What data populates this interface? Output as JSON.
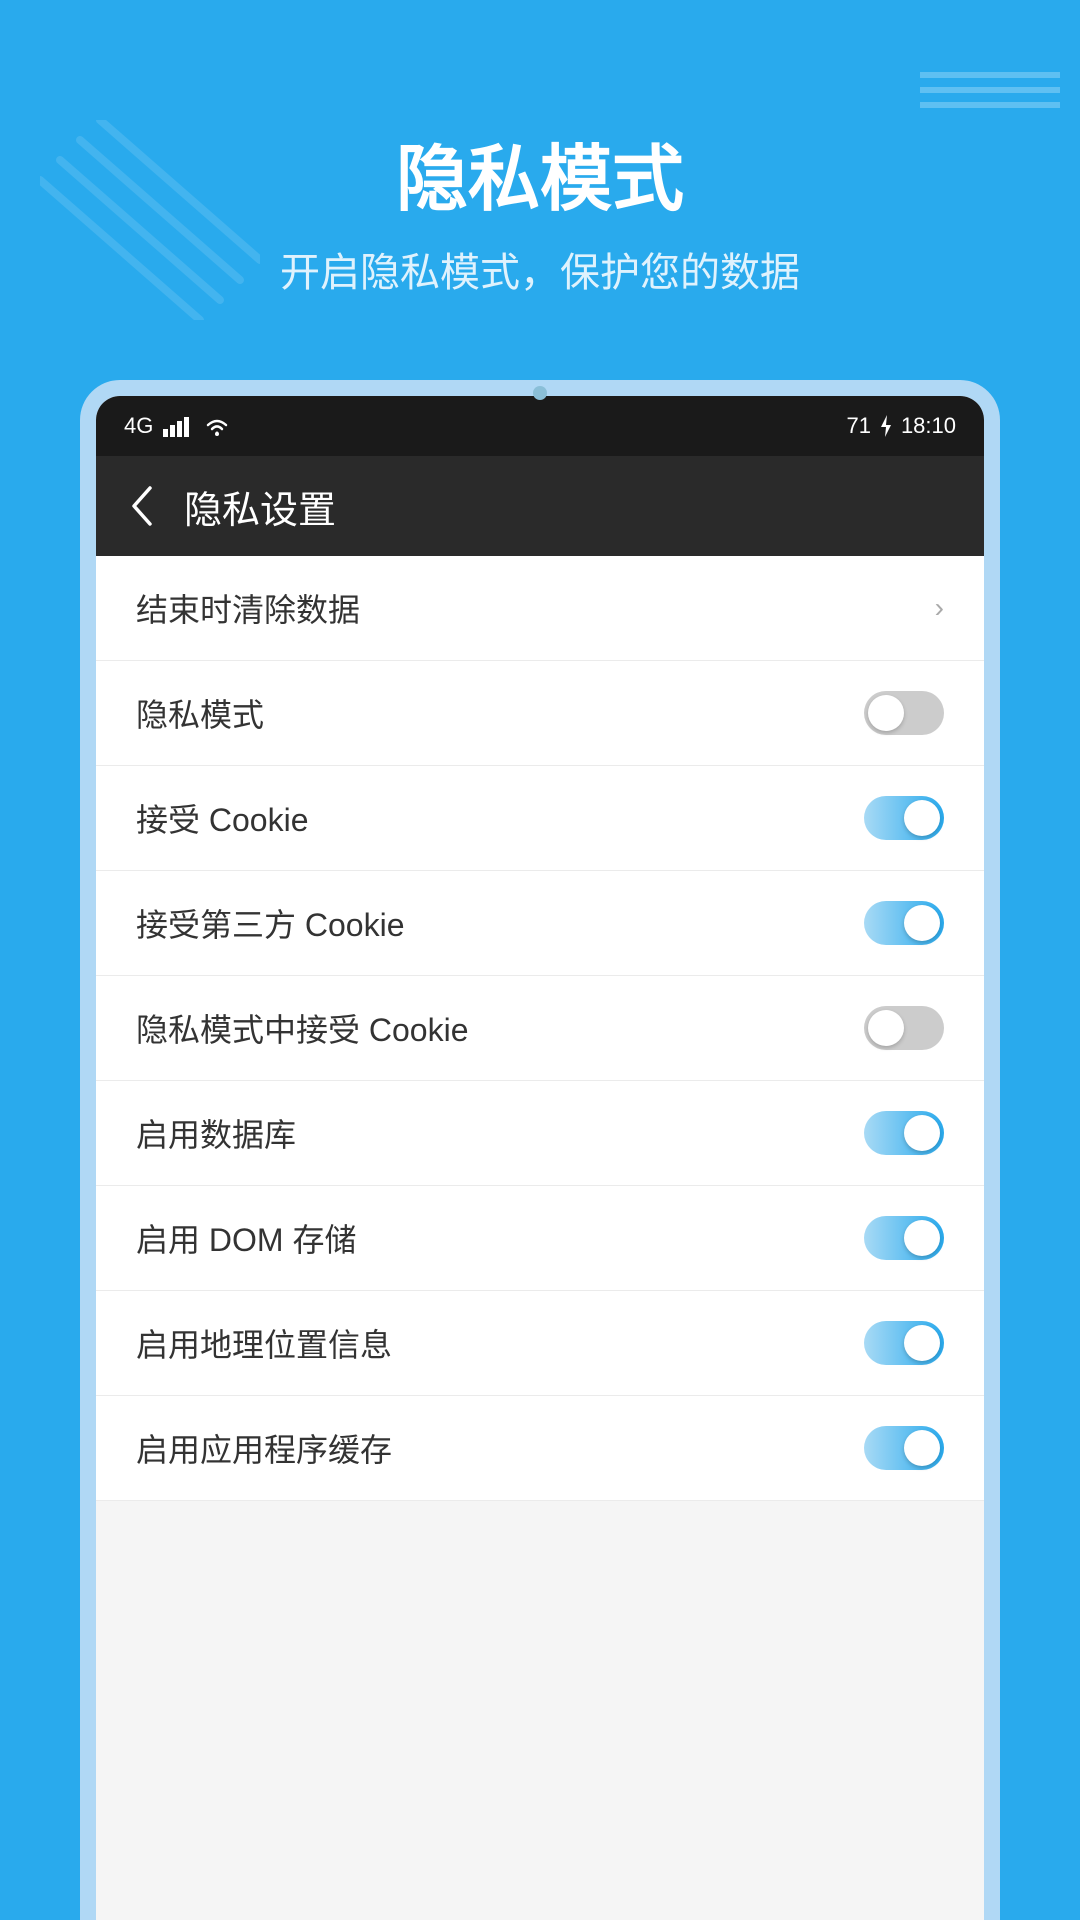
{
  "background_color": "#29aaed",
  "page": {
    "title": "隐私模式",
    "subtitle": "开启隐私模式，保护您的数据"
  },
  "status_bar": {
    "signal": "4G",
    "battery": "71",
    "time": "18:10"
  },
  "nav": {
    "back_label": "←",
    "title": "隐私设置"
  },
  "settings_items": [
    {
      "id": "clear-data",
      "label": "结束时清除数据",
      "toggle": false,
      "has_toggle": false
    },
    {
      "id": "private-mode",
      "label": "隐私模式",
      "toggle": false,
      "has_toggle": true
    },
    {
      "id": "accept-cookie",
      "label": "接受 Cookie",
      "toggle": true,
      "has_toggle": true
    },
    {
      "id": "accept-third-party-cookie",
      "label": "接受第三方 Cookie",
      "toggle": true,
      "has_toggle": true
    },
    {
      "id": "private-cookie",
      "label": "隐私模式中接受 Cookie",
      "toggle": false,
      "has_toggle": true
    },
    {
      "id": "enable-database",
      "label": "启用数据库",
      "toggle": true,
      "has_toggle": true
    },
    {
      "id": "enable-dom",
      "label": "启用 DOM 存储",
      "toggle": true,
      "has_toggle": true
    },
    {
      "id": "enable-geolocation",
      "label": "启用地理位置信息",
      "toggle": true,
      "has_toggle": true
    },
    {
      "id": "enable-appcache",
      "label": "启用应用程序缓存",
      "toggle": true,
      "has_toggle": true
    }
  ]
}
